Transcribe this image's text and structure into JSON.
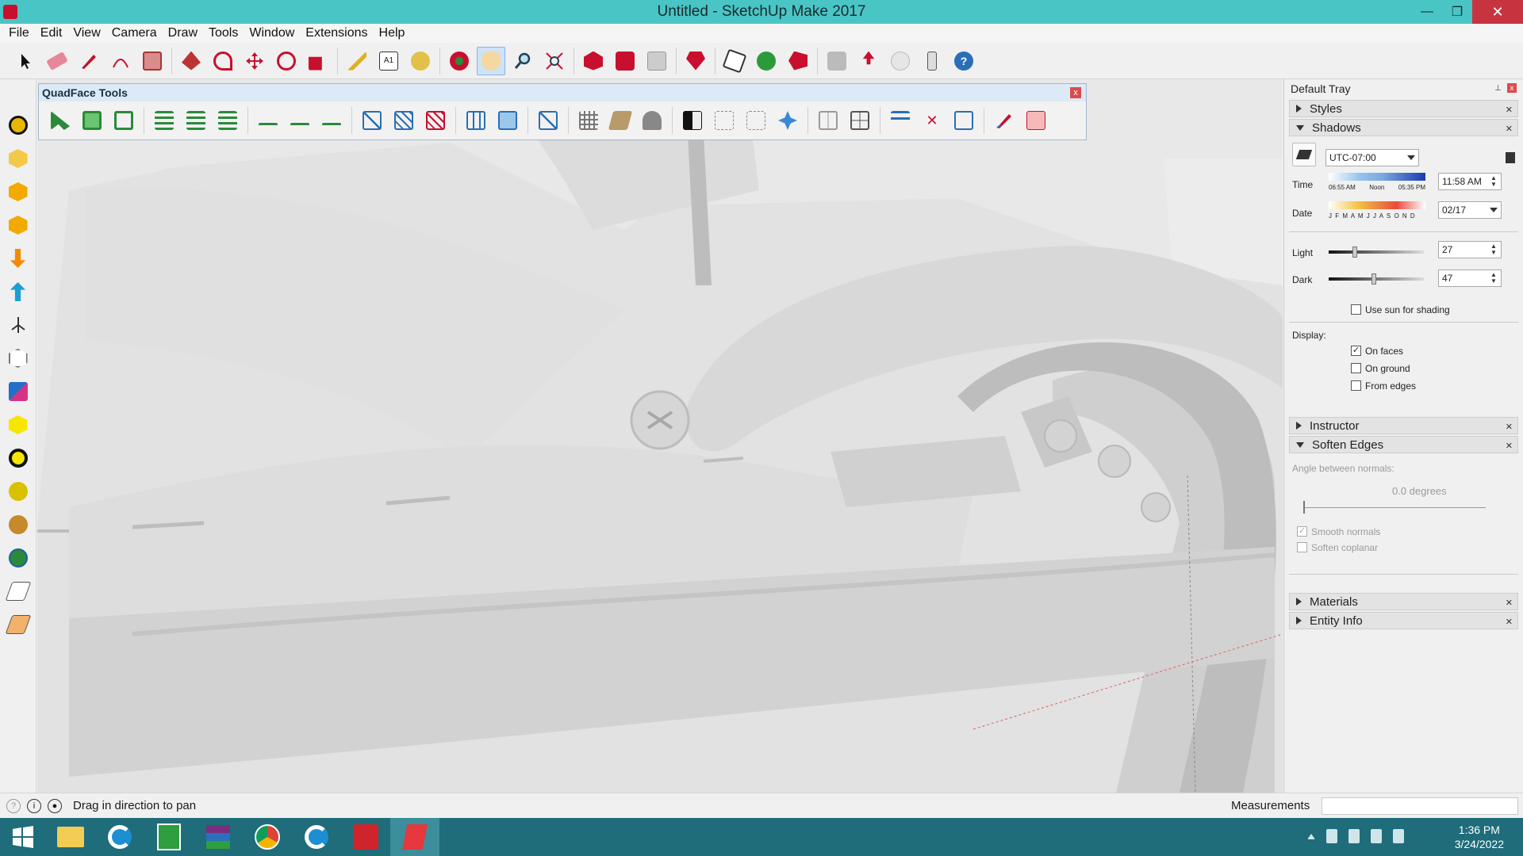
{
  "window": {
    "title": "Untitled - SketchUp Make 2017",
    "min": "—",
    "max": "❐",
    "close": "✕"
  },
  "menu": [
    "File",
    "Edit",
    "View",
    "Camera",
    "Draw",
    "Tools",
    "Window",
    "Extensions",
    "Help"
  ],
  "quadface": {
    "title": "QuadFace Tools",
    "close": "x"
  },
  "tray": {
    "title": "Default Tray",
    "pin": "⊥",
    "close": "x",
    "panels": {
      "styles": "Styles",
      "shadows": "Shadows",
      "instructor": "Instructor",
      "soften_edges": "Soften Edges",
      "materials": "Materials",
      "entity_info": "Entity Info"
    },
    "shadows": {
      "timezone": "UTC-07:00",
      "time_label": "Time",
      "time_ticks": [
        "06:55 AM",
        "Noon",
        "05:35 PM"
      ],
      "time_value": "11:58 AM",
      "date_label": "Date",
      "date_months": "J F M A M J J A S O N D",
      "date_value": "02/17",
      "light_label": "Light",
      "light_value": "27",
      "dark_label": "Dark",
      "dark_value": "47",
      "use_sun": "Use sun for shading",
      "display_label": "Display:",
      "on_faces": "On faces",
      "on_ground": "On ground",
      "from_edges": "From edges"
    },
    "soften": {
      "angle_label": "Angle between normals:",
      "angle_value": "0.0  degrees",
      "smooth_normals": "Smooth normals",
      "soften_coplanar": "Soften coplanar"
    }
  },
  "status": {
    "text": "Drag in direction to pan",
    "measurements_label": "Measurements"
  },
  "taskbar": {
    "time": "1:36 PM",
    "date": "3/24/2022"
  },
  "colors": {
    "titlebar": "#49c5c6",
    "taskbar": "#1f6c7a",
    "close_red": "#c7343f"
  }
}
